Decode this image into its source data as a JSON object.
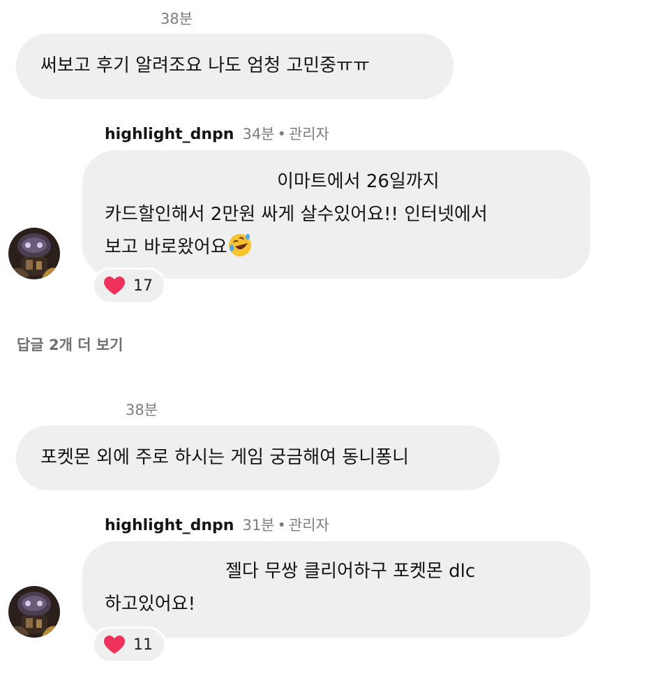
{
  "threads": [
    {
      "comment": {
        "time": "38분",
        "text": "써보고 후기 알려조요 나도 엄청 고민중ㅠㅠ"
      },
      "reply": {
        "username": "highlight_dnpn",
        "time": "34분",
        "separator": "•",
        "role": "관리자",
        "lines": [
          "이마트에서 26일까지",
          "카드할인해서 2만원 싸게 살수있어요!! 인터넷에서",
          "보고 바로왔어요"
        ],
        "emoji": "rolling-on-floor-laughing-emoji",
        "likes": "17"
      }
    },
    {
      "comment": {
        "time": "38분",
        "text": "포켓몬 외에 주로 하시는 게임 궁금해여 동니퐁니"
      },
      "reply": {
        "username": "highlight_dnpn",
        "time": "31분",
        "separator": "•",
        "role": "관리자",
        "lines": [
          "젤다 무쌍 클리어하구 포켓몬 dlc",
          "하고있어요!"
        ],
        "likes": "11"
      }
    }
  ],
  "more_replies_label": "답글 2개 더 보기",
  "colors": {
    "bubble": "#efefef",
    "meta": "#7d7d7d",
    "heart": "#f0325a"
  }
}
